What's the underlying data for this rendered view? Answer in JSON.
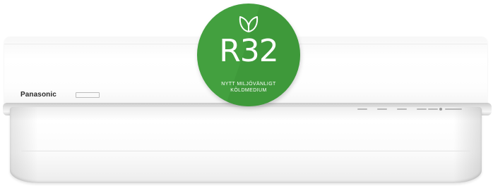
{
  "product": {
    "brand": "Panasonic"
  },
  "badge": {
    "icon": "leaf-icon",
    "title": "R32",
    "line1": "NYTT MILJÖVÄNLIGT",
    "line2": "KÖLDMEDIUM",
    "color": "#43a03f"
  }
}
